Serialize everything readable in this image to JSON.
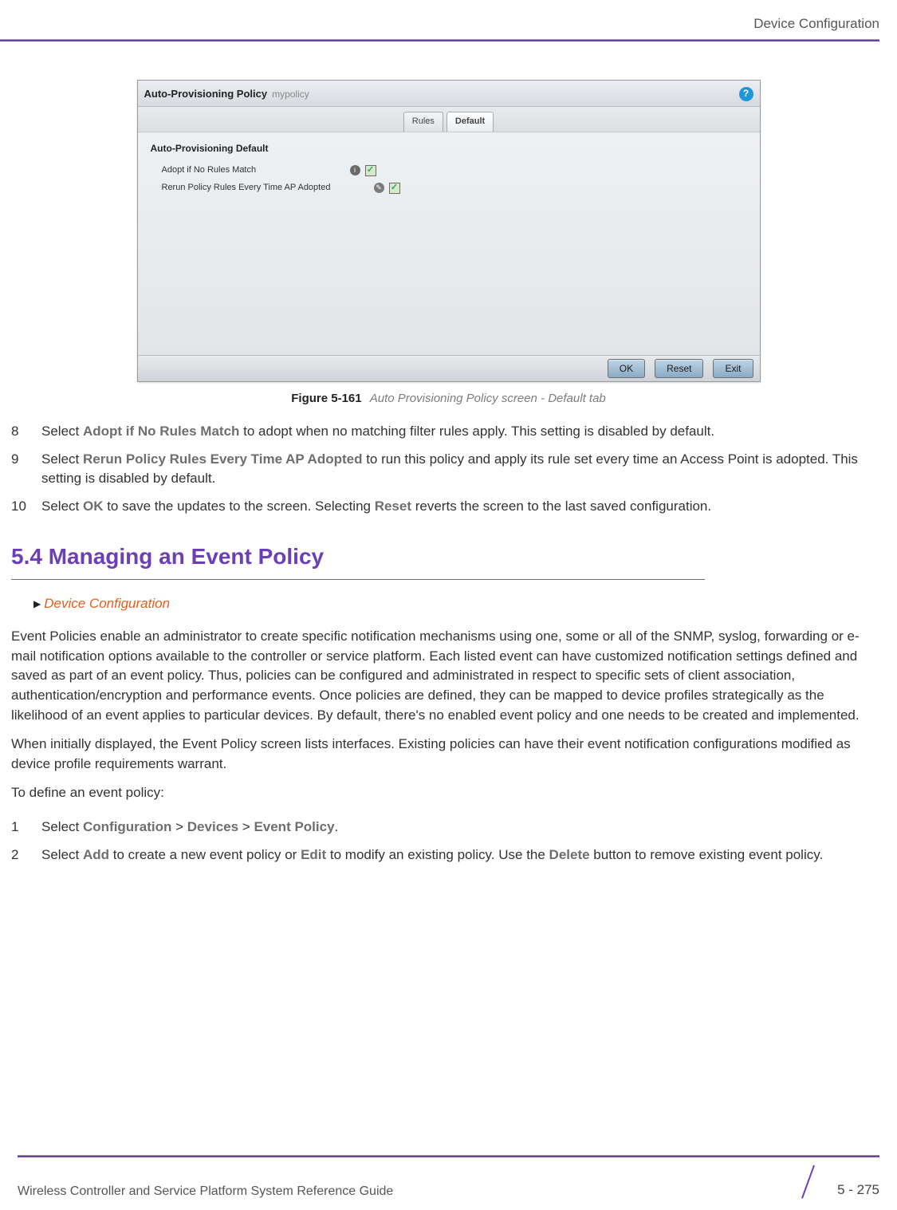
{
  "header": {
    "section": "Device Configuration"
  },
  "footer": {
    "guide_title": "Wireless Controller and Service Platform System Reference Guide",
    "page_num": "5 - 275"
  },
  "figure": {
    "label": "Figure 5-161",
    "caption": "Auto Provisioning Policy screen - Default tab",
    "window": {
      "title": "Auto-Provisioning Policy",
      "subtitle": "mypolicy",
      "help_glyph": "?",
      "tabs": {
        "rules": "Rules",
        "default": "Default"
      },
      "section_title": "Auto-Provisioning Default",
      "row1_label": "Adopt if No Rules Match",
      "row2_label": "Rerun Policy Rules Every Time AP Adopted",
      "buttons": {
        "ok": "OK",
        "reset": "Reset",
        "exit": "Exit"
      }
    }
  },
  "steps_a": {
    "s8_pre": "Select ",
    "s8_bold": "Adopt if No Rules Match",
    "s8_post": " to adopt when no matching filter rules apply. This setting is disabled by default.",
    "s9_pre": "Select ",
    "s9_bold": "Rerun Policy Rules Every Time AP Adopted",
    "s9_post": " to run this policy and apply its rule set every time an Access Point is adopted. This setting is disabled by default.",
    "s10_pre": "Select ",
    "s10_b1": "OK",
    "s10_mid": " to save the updates to the screen. Selecting ",
    "s10_b2": "Reset",
    "s10_post": " reverts the screen to the last saved configuration."
  },
  "section": {
    "heading": "5.4 Managing an Event Policy",
    "breadcrumb": "Device Configuration",
    "para1": "Event Policies enable an administrator to create specific notification mechanisms using one, some or all of the SNMP, syslog, forwarding or e-mail notification options available to the controller or service platform. Each listed event can have customized notification settings defined and saved as part of an event policy. Thus, policies can be configured and administrated in respect to specific sets of client association, authentication/encryption and performance events. Once policies are defined, they can be mapped to device profiles strategically as the likelihood of an event applies to particular devices. By default, there's no enabled event policy and one needs to be created and implemented.",
    "para2": "When initially displayed, the Event Policy screen lists interfaces. Existing policies can have their event notification configurations modified as device profile requirements warrant.",
    "para3": "To define an event policy:"
  },
  "steps_b": {
    "s1_pre": "Select ",
    "s1_b1": "Configuration",
    "s1_m1": " > ",
    "s1_b2": "Devices",
    "s1_m2": " > ",
    "s1_b3": "Event Policy",
    "s1_post": ".",
    "s2_pre": "Select ",
    "s2_b1": "Add",
    "s2_m1": " to create a new event policy or ",
    "s2_b2": "Edit",
    "s2_m2": " to modify an existing policy. Use the ",
    "s2_b3": "Delete",
    "s2_post": " button to remove existing event policy."
  },
  "nums": {
    "n8": "8",
    "n9": "9",
    "n10": "10",
    "n1": "1",
    "n2": "2"
  }
}
